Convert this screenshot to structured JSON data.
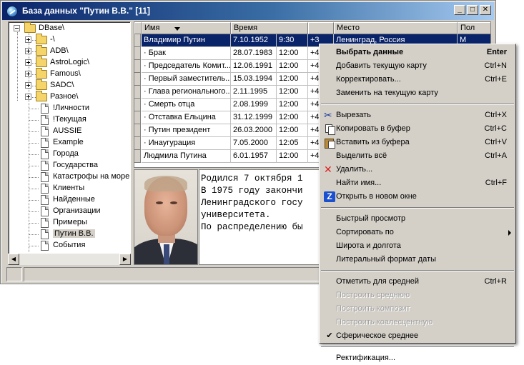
{
  "window": {
    "title": "База данных \"Путин В.В.\"  [11]",
    "controls": {
      "minimize": "_",
      "maximize": "□",
      "close": "✕"
    }
  },
  "tree": {
    "root": "DBase\\",
    "items": [
      {
        "label": "-\\",
        "kind": "folder"
      },
      {
        "label": "ADB\\",
        "kind": "folder"
      },
      {
        "label": "AstroLogic\\",
        "kind": "folder"
      },
      {
        "label": "Famous\\",
        "kind": "folder"
      },
      {
        "label": "SADC\\",
        "kind": "folder"
      },
      {
        "label": "Разное\\",
        "kind": "folder"
      },
      {
        "label": "!Личности",
        "kind": "file"
      },
      {
        "label": "!Текущая",
        "kind": "file"
      },
      {
        "label": "AUSSIE",
        "kind": "file"
      },
      {
        "label": "Example",
        "kind": "file"
      },
      {
        "label": "Города",
        "kind": "file"
      },
      {
        "label": "Государства",
        "kind": "file"
      },
      {
        "label": "Катастрофы на море",
        "kind": "file"
      },
      {
        "label": "Клиенты",
        "kind": "file"
      },
      {
        "label": "Найденные",
        "kind": "file"
      },
      {
        "label": "Организации",
        "kind": "file"
      },
      {
        "label": "Примеры",
        "kind": "file"
      },
      {
        "label": "Путин В.В.",
        "kind": "file",
        "selected": true
      },
      {
        "label": "События",
        "kind": "file"
      }
    ]
  },
  "grid": {
    "columns": [
      "Имя",
      "Время",
      "",
      "Место",
      "Пол"
    ],
    "rows": [
      {
        "name": "Владимир Путин",
        "date": "7.10.1952",
        "time": "9:30",
        "tz": "+3",
        "place": "Ленинград, Россия",
        "sex": "М",
        "active": true
      },
      {
        "name": "· Брак",
        "date": "28.07.1983",
        "time": "12:00",
        "tz": "+4",
        "place": "",
        "sex": ""
      },
      {
        "name": "· Председатель Комит...",
        "date": "12.06.1991",
        "time": "12:00",
        "tz": "+4",
        "place": "",
        "sex": ""
      },
      {
        "name": "· Первый заместитель...",
        "date": "15.03.1994",
        "time": "12:00",
        "tz": "+4",
        "place": "",
        "sex": ""
      },
      {
        "name": "· Глава регионального...",
        "date": "2.11.1995",
        "time": "12:00",
        "tz": "+4",
        "place": "",
        "sex": ""
      },
      {
        "name": "· Смерть отца",
        "date": "2.08.1999",
        "time": "12:00",
        "tz": "+4",
        "place": "",
        "sex": ""
      },
      {
        "name": "· Отставка Ельцина",
        "date": "31.12.1999",
        "time": "12:00",
        "tz": "+4",
        "place": "",
        "sex": ""
      },
      {
        "name": "· Путин президент",
        "date": "26.03.2000",
        "time": "12:00",
        "tz": "+4",
        "place": "",
        "sex": ""
      },
      {
        "name": "· Инаугурация",
        "date": "7.05.2000",
        "time": "12:05",
        "tz": "+4",
        "place": "",
        "sex": ""
      },
      {
        "name": "Людмила Путина",
        "date": "6.01.1957",
        "time": "12:00",
        "tz": "+4",
        "place": "",
        "sex": ""
      }
    ]
  },
  "bio": {
    "lines": [
      "Родился 7 октября 1",
      "",
      "В 1975 году закончи",
      "Ленинградского госу",
      "университета.",
      "",
      "По распределению бы"
    ]
  },
  "context_menu": {
    "items": [
      {
        "label": "Выбрать данные",
        "shortcut": "Enter",
        "bold": true
      },
      {
        "label": "Добавить текущую карту",
        "shortcut": "Ctrl+N"
      },
      {
        "label": "Корректировать...",
        "shortcut": "Ctrl+E"
      },
      {
        "label": "Заменить на текущую карту",
        "shortcut": ""
      },
      {
        "separator": true
      },
      {
        "label": "Вырезать",
        "shortcut": "Ctrl+X",
        "icon": "scissors-icon"
      },
      {
        "label": "Копировать в буфер",
        "shortcut": "Ctrl+C",
        "icon": "copy-icon"
      },
      {
        "label": "Вставить из буфера",
        "shortcut": "Ctrl+V",
        "icon": "paste-icon"
      },
      {
        "label": "Выделить всё",
        "shortcut": "Ctrl+A"
      },
      {
        "label": "Удалить...",
        "shortcut": "",
        "icon": "delete-x-icon"
      },
      {
        "label": "Найти имя...",
        "shortcut": "Ctrl+F"
      },
      {
        "label": "Открыть в новом окне",
        "shortcut": "",
        "icon": "z-window-icon"
      },
      {
        "separator": true
      },
      {
        "label": "Быстрый просмотр",
        "shortcut": ""
      },
      {
        "label": "Сортировать по",
        "shortcut": "",
        "submenu": true
      },
      {
        "label": "Широта и долгота",
        "shortcut": ""
      },
      {
        "label": "Литеральный формат даты",
        "shortcut": ""
      },
      {
        "separator": true
      },
      {
        "label": "Отметить для средней",
        "shortcut": "Ctrl+R"
      },
      {
        "label": "Построить среднюю",
        "shortcut": "",
        "disabled": true
      },
      {
        "label": "Построить композит",
        "shortcut": "",
        "disabled": true
      },
      {
        "label": "Построить коалесцентную",
        "shortcut": "",
        "disabled": true
      },
      {
        "label": "Сферическое среднее",
        "shortcut": "",
        "checked": true
      },
      {
        "separator": true
      },
      {
        "label": "Ректификация...",
        "shortcut": ""
      }
    ]
  },
  "colors": {
    "selection": "#0a246a",
    "chrome": "#d4d0c8",
    "delete_icon": "#e02020",
    "scissors_icon": "#1a3a9a"
  }
}
